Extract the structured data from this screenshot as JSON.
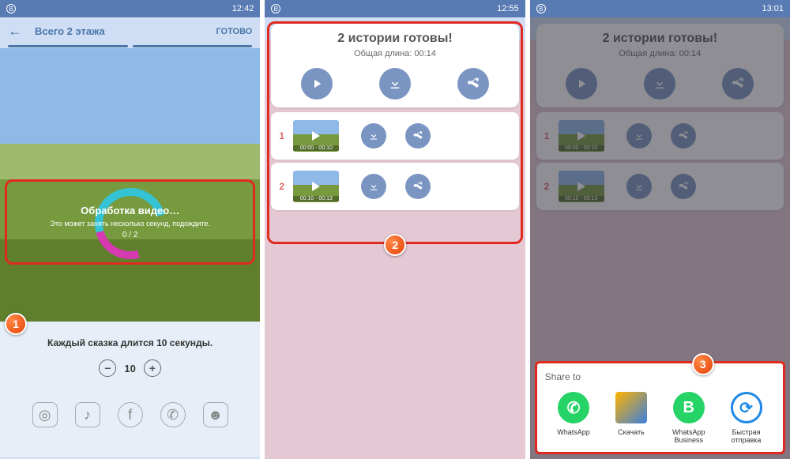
{
  "status": {
    "b": "B",
    "t1": "12:42",
    "t2": "12:55",
    "t3": "13:01"
  },
  "p1": {
    "back": "←",
    "title": "Всего 2 этажа",
    "done": "ГОТОВО",
    "ov_title": "Обработка видео…",
    "ov_sub": "Это может занять несколько секунд, подождите.",
    "ov_count": "0 / 2",
    "foot": "Каждый сказка длится 10 секунды.",
    "minus": "−",
    "plus": "+",
    "value": "10"
  },
  "card": {
    "title": "2 истории готовы!",
    "sub": "Общая длина: 00:14",
    "rows": [
      {
        "n": "1",
        "time": "00:00 - 00:10"
      },
      {
        "n": "2",
        "time": "00:10 - 00:13"
      }
    ]
  },
  "share": {
    "title": "Share to",
    "apps": [
      {
        "label": "WhatsApp"
      },
      {
        "label": "Скачать"
      },
      {
        "label": "WhatsApp Business"
      },
      {
        "label": "Быстрая отправка"
      }
    ]
  },
  "markers": {
    "m1": "1",
    "m2": "2",
    "m3": "3"
  }
}
